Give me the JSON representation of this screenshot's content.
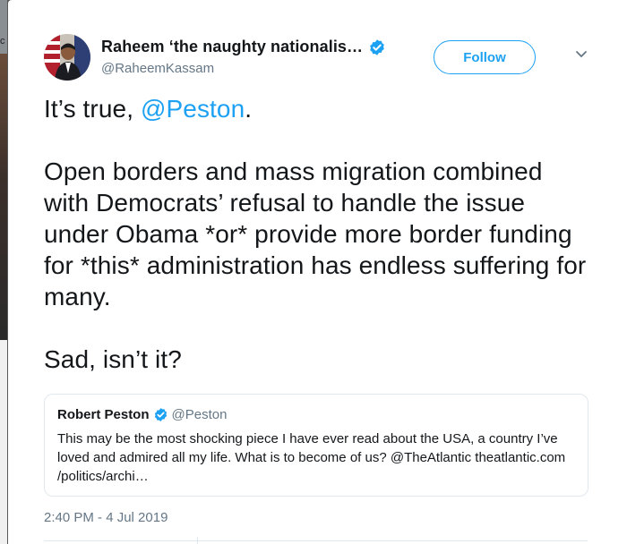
{
  "background": {
    "edge_glyph": "c"
  },
  "author": {
    "display_name": "Raheem ‘the naughty nationalis…",
    "handle": "@RaheemKassam",
    "verified": true,
    "follow_label": "Follow"
  },
  "tweet": {
    "line1_prefix": "It’s true, ",
    "line1_mention": "@Peston",
    "line1_suffix": ".",
    "paragraph2": "Open borders and mass migration combined with Democrats’ refusal to handle the issue under Obama *or* provide more border funding for *this* administration has endless suffering for many.",
    "paragraph3": "Sad, isn’t it?"
  },
  "quoted_tweet": {
    "display_name": "Robert Peston",
    "handle": "@Peston",
    "verified": true,
    "body": "This may be the most shocking piece I have ever read about the USA, a country I’ve loved and admired all my life. What is to become of us? @TheAtlantic  theatlantic.com /politics/archi…"
  },
  "timestamp": "2:40 PM - 4 Jul 2019",
  "colors": {
    "accent": "#1da1f2",
    "text": "#14171a",
    "muted": "#657786",
    "border": "#e1e8ed"
  },
  "icons": {
    "verified": "verified-badge-icon",
    "caret": "chevron-down-icon"
  }
}
